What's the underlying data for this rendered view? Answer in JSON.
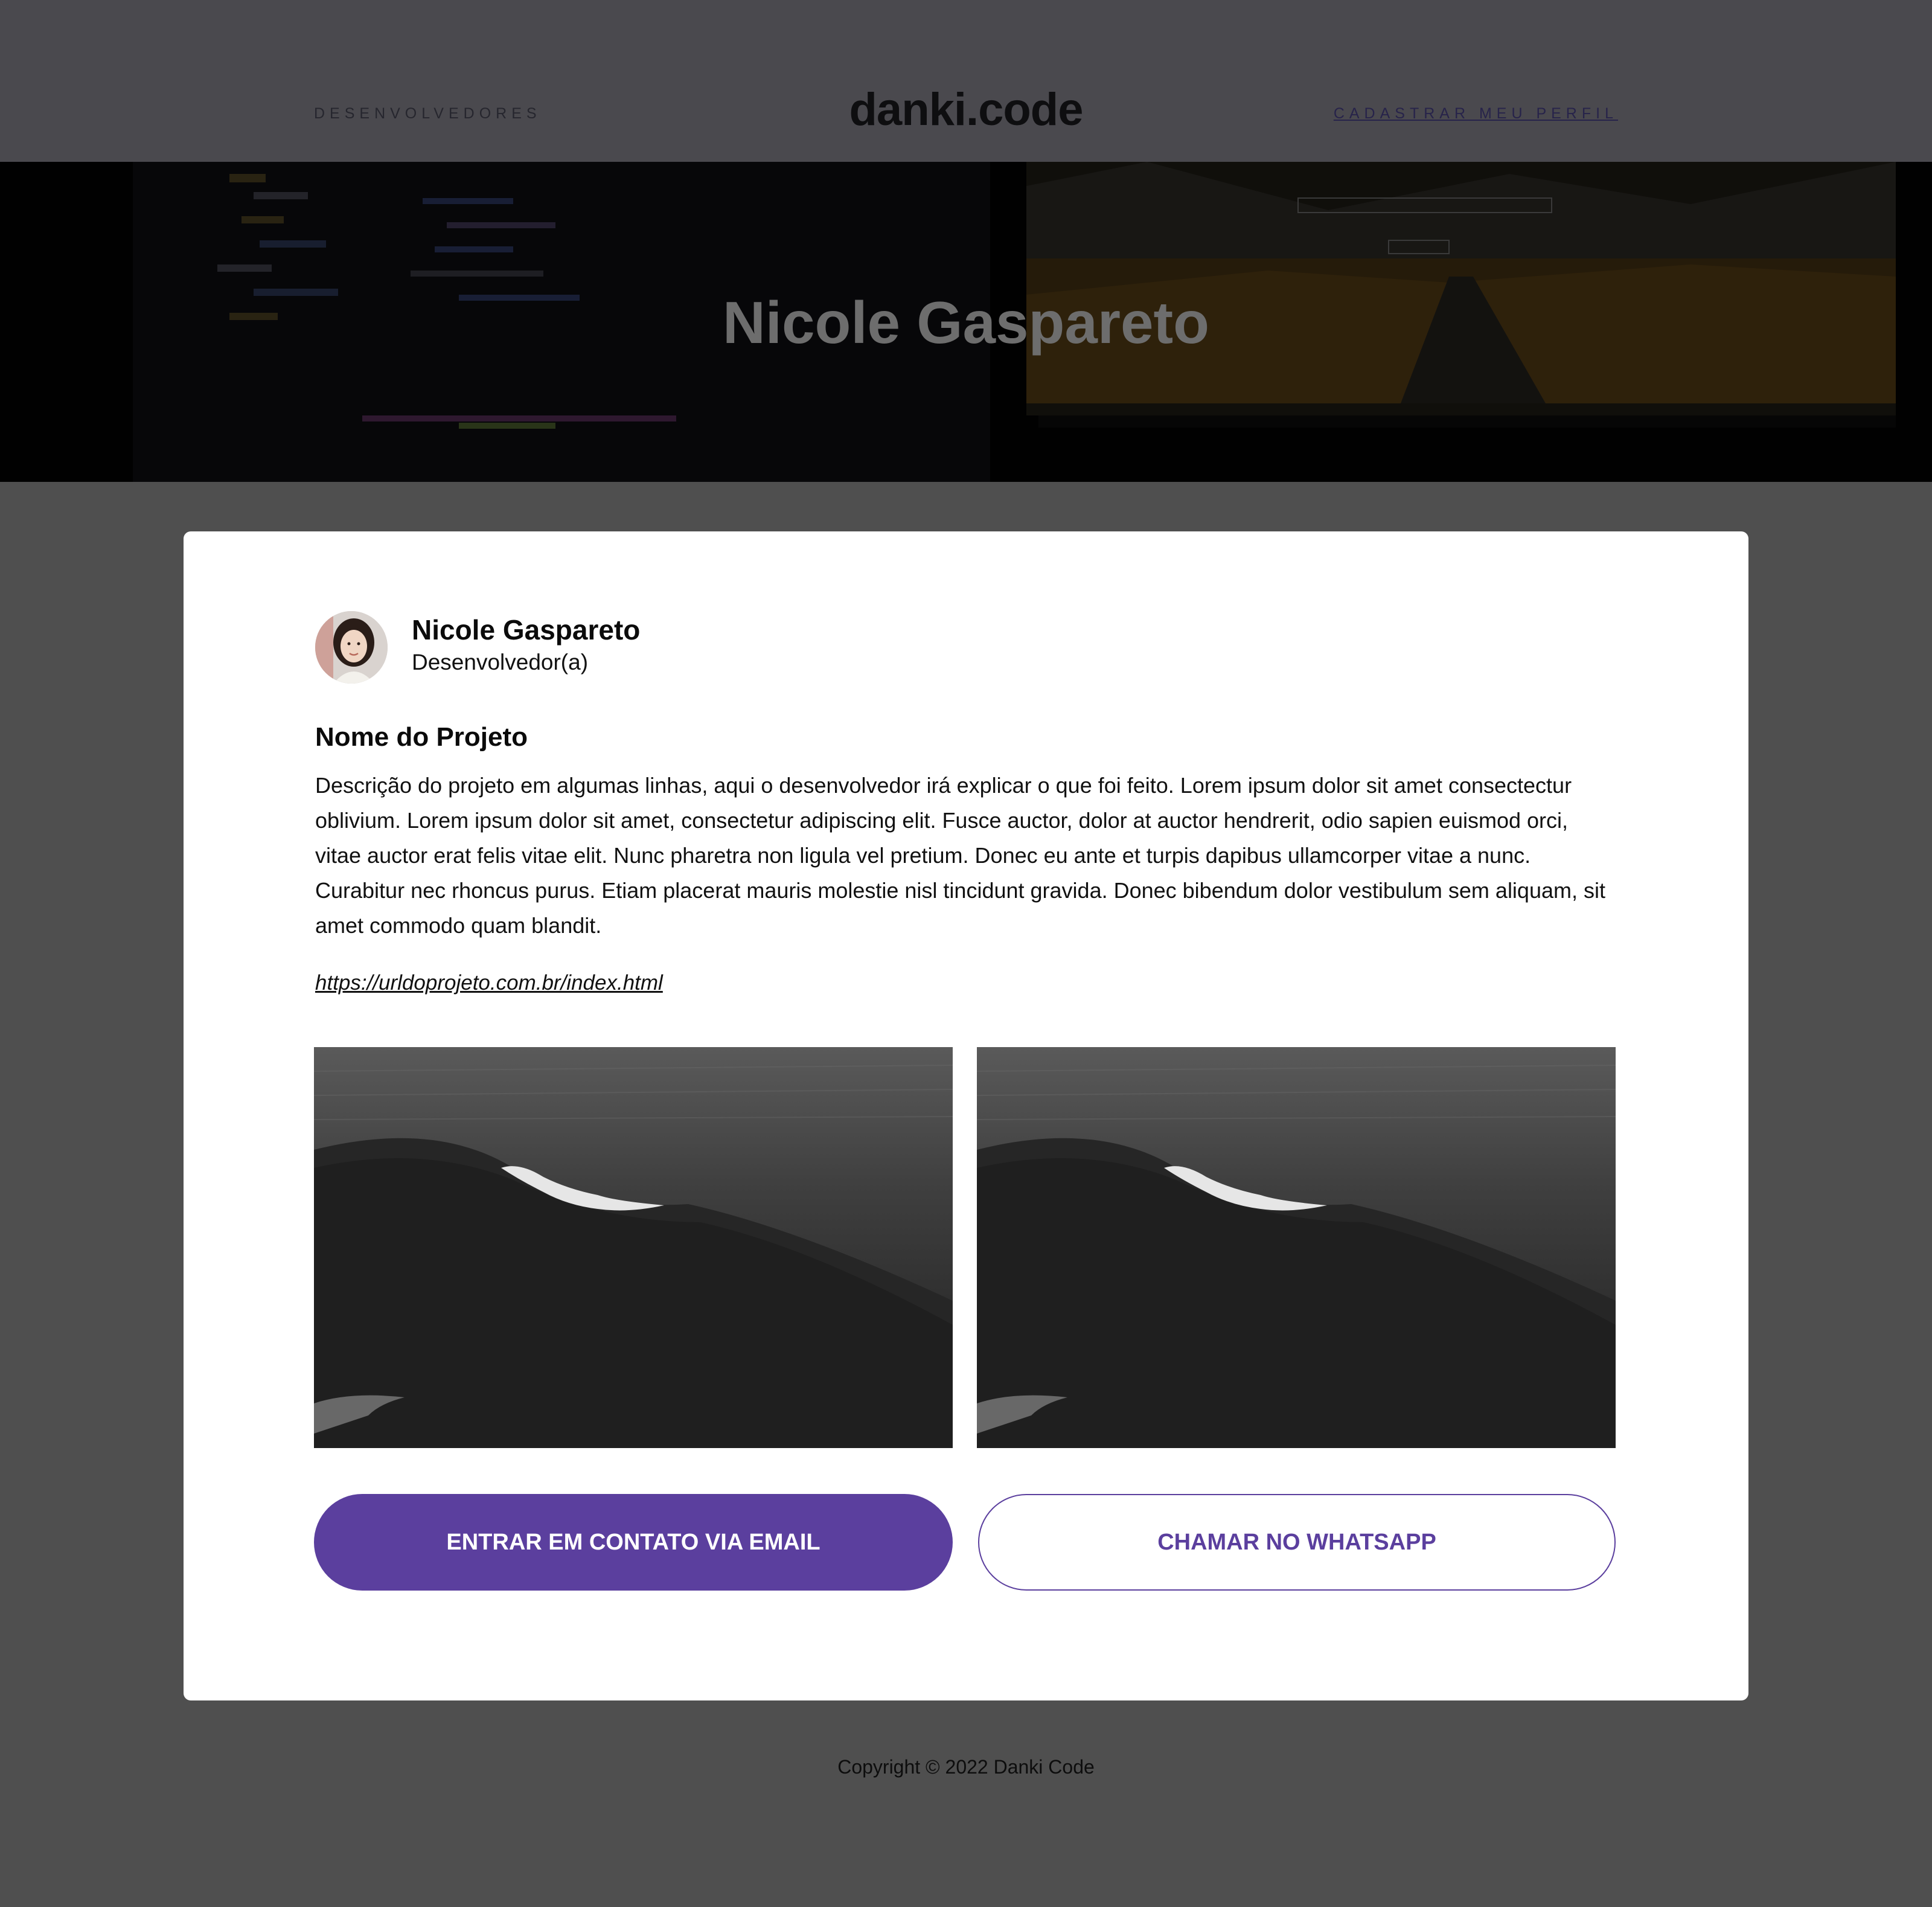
{
  "header": {
    "nav_left": "DESENVOLVEDORES",
    "logo": "danki.code",
    "nav_right": "CADASTRAR MEU PERFIL"
  },
  "hero": {
    "title": "Nicole Gaspareto"
  },
  "profile": {
    "name": "Nicole Gaspareto",
    "role": "Desenvolvedor(a)"
  },
  "project": {
    "title": "Nome do Projeto",
    "description": "Descrição do projeto em algumas linhas, aqui o desenvolvedor irá explicar o que foi feito. Lorem ipsum dolor sit amet consectectur oblivium. Lorem ipsum dolor sit amet, consectetur adipiscing elit. Fusce auctor, dolor at auctor hendrerit, odio sapien euismod orci, vitae auctor erat felis vitae elit. Nunc pharetra non ligula vel pretium. Donec eu ante et turpis dapibus ullamcorper vitae a nunc. Curabitur nec rhoncus purus. Etiam placerat mauris molestie nisl tincidunt gravida. Donec bibendum dolor vestibulum sem aliquam, sit amet commodo quam blandit.",
    "url": "https://urldoprojeto.com.br/index.html"
  },
  "actions": {
    "email_label": "ENTRAR EM CONTATO VIA EMAIL",
    "whatsapp_label": "CHAMAR NO WHATSAPP"
  },
  "footer": {
    "copyright": "Copyright © 2022  Danki Code"
  },
  "colors": {
    "accent": "#5b3f9e",
    "page_bg": "#4f4f4f",
    "header_bg": "#4a494e"
  }
}
